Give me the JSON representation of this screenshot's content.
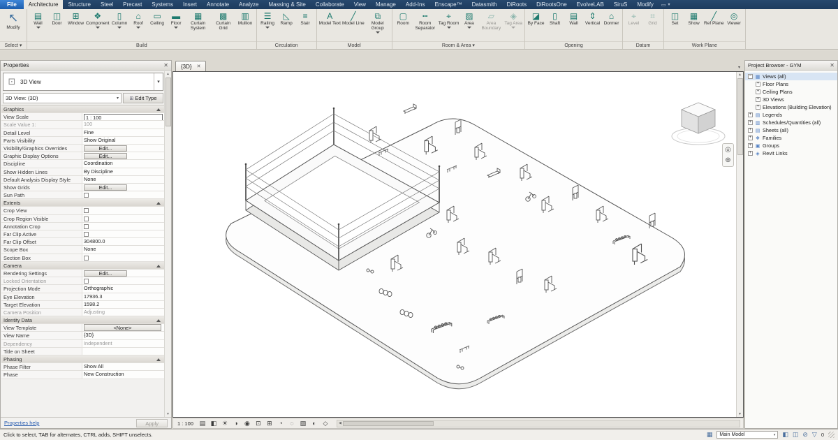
{
  "icons": {
    "close": "✕",
    "dropdown": "▾",
    "up": "▲",
    "down": "▼",
    "left": "◀",
    "panel": "▭",
    "view3d": "⊡",
    "edittype": "⊞",
    "wheel": "◎",
    "pan": "⊕",
    "worksets": "▦",
    "designopt": "◧",
    "editable": "◫",
    "exclude": "⊘",
    "filter": "▽"
  },
  "ribbon": {
    "tabs": [
      {
        "label": "File",
        "cls": "file"
      },
      {
        "label": "Architecture",
        "cls": "active"
      },
      {
        "label": "Structure",
        "cls": ""
      },
      {
        "label": "Steel",
        "cls": ""
      },
      {
        "label": "Precast",
        "cls": ""
      },
      {
        "label": "Systems",
        "cls": ""
      },
      {
        "label": "Insert",
        "cls": ""
      },
      {
        "label": "Annotate",
        "cls": ""
      },
      {
        "label": "Analyze",
        "cls": ""
      },
      {
        "label": "Massing & Site",
        "cls": ""
      },
      {
        "label": "Collaborate",
        "cls": ""
      },
      {
        "label": "View",
        "cls": ""
      },
      {
        "label": "Manage",
        "cls": ""
      },
      {
        "label": "Add-Ins",
        "cls": ""
      },
      {
        "label": "Enscape™",
        "cls": ""
      },
      {
        "label": "Datasmith",
        "cls": ""
      },
      {
        "label": "DiRoots",
        "cls": ""
      },
      {
        "label": "DiRootsOne",
        "cls": ""
      },
      {
        "label": "EvolveLAB",
        "cls": ""
      },
      {
        "label": "SiruS",
        "cls": ""
      },
      {
        "label": "Modify",
        "cls": ""
      }
    ],
    "select": {
      "label": "Select ▾",
      "items": [
        {
          "label": "Modify",
          "glyph": "↖",
          "cls": "big"
        }
      ]
    },
    "build": {
      "label": "Build",
      "items": [
        {
          "label": "Wall",
          "glyph": "▤",
          "cls": "has-arrow"
        },
        {
          "label": "Door",
          "glyph": "◫",
          "cls": ""
        },
        {
          "label": "Window",
          "glyph": "⊞",
          "cls": ""
        },
        {
          "label": "Component",
          "glyph": "❖",
          "cls": "has-arrow"
        },
        {
          "label": "Column",
          "glyph": "▯",
          "cls": "has-arrow"
        },
        {
          "label": "Roof",
          "glyph": "⌂",
          "cls": "has-arrow"
        },
        {
          "label": "Ceiling",
          "glyph": "▭",
          "cls": ""
        },
        {
          "label": "Floor",
          "glyph": "▬",
          "cls": "has-arrow"
        },
        {
          "label": "Curtain System",
          "glyph": "▦",
          "cls": ""
        },
        {
          "label": "Curtain Grid",
          "glyph": "▩",
          "cls": ""
        },
        {
          "label": "Mullion",
          "glyph": "▥",
          "cls": ""
        }
      ]
    },
    "circulation": {
      "label": "Circulation",
      "items": [
        {
          "label": "Railing",
          "glyph": "☰",
          "cls": "has-arrow"
        },
        {
          "label": "Ramp",
          "glyph": "◺",
          "cls": ""
        },
        {
          "label": "Stair",
          "glyph": "≡",
          "cls": ""
        }
      ]
    },
    "model": {
      "label": "Model",
      "items": [
        {
          "label": "Model Text",
          "glyph": "A",
          "cls": ""
        },
        {
          "label": "Model Line",
          "glyph": "╱",
          "cls": ""
        },
        {
          "label": "Model Group",
          "glyph": "⧉",
          "cls": "has-arrow"
        }
      ]
    },
    "room": {
      "label": "Room & Area ▾",
      "items": [
        {
          "label": "Room",
          "glyph": "▢",
          "cls": ""
        },
        {
          "label": "Room Separator",
          "glyph": "┅",
          "cls": ""
        },
        {
          "label": "Tag Room",
          "glyph": "⌖",
          "cls": "has-arrow"
        },
        {
          "label": "Area",
          "glyph": "▨",
          "cls": "has-arrow"
        },
        {
          "label": "Area Boundary",
          "glyph": "▱",
          "cls": "dim"
        },
        {
          "label": "Tag Area",
          "glyph": "◈",
          "cls": "has-arrow dim"
        }
      ]
    },
    "opening": {
      "label": "Opening",
      "items": [
        {
          "label": "By Face",
          "glyph": "◪",
          "cls": ""
        },
        {
          "label": "Shaft",
          "glyph": "▯",
          "cls": ""
        },
        {
          "label": "Wall",
          "glyph": "▤",
          "cls": ""
        },
        {
          "label": "Vertical",
          "glyph": "⇕",
          "cls": ""
        },
        {
          "label": "Dormer",
          "glyph": "⌂",
          "cls": ""
        }
      ]
    },
    "datum": {
      "label": "Datum",
      "items": [
        {
          "label": "Level",
          "glyph": "⌖",
          "cls": "dim"
        },
        {
          "label": "Grid",
          "glyph": "⌗",
          "cls": "dim"
        }
      ]
    },
    "workplane": {
      "label": "Work Plane",
      "items": [
        {
          "label": "Set",
          "glyph": "◫",
          "cls": ""
        },
        {
          "label": "Show",
          "glyph": "▦",
          "cls": ""
        },
        {
          "label": "Ref Plane",
          "glyph": "╱",
          "cls": ""
        },
        {
          "label": "Viewer",
          "glyph": "◎",
          "cls": ""
        }
      ]
    }
  },
  "properties": {
    "title": "Properties",
    "type_selector": "3D View",
    "view_selector": "3D View: (3D)",
    "edit_type": "Edit Type",
    "help": "Properties help",
    "apply": "Apply",
    "rows": [
      {
        "label": "Graphics",
        "value": "",
        "cls": "header"
      },
      {
        "label": "View Scale",
        "value": "1 : 100",
        "cls": "input"
      },
      {
        "label": "Scale Value    1:",
        "value": "100",
        "cls": "dim"
      },
      {
        "label": "Detail Level",
        "value": "Fine",
        "cls": ""
      },
      {
        "label": "Parts Visibility",
        "value": "Show Original",
        "cls": ""
      },
      {
        "label": "Visibility/Graphics Overrides",
        "value": "Edit...",
        "cls": "edit"
      },
      {
        "label": "Graphic Display Options",
        "value": "Edit...",
        "cls": "edit"
      },
      {
        "label": "Discipline",
        "value": "Coordination",
        "cls": ""
      },
      {
        "label": "Show Hidden Lines",
        "value": "By Discipline",
        "cls": ""
      },
      {
        "label": "Default Analysis Display Style",
        "value": "None",
        "cls": ""
      },
      {
        "label": "Show Grids",
        "value": "Edit...",
        "cls": "edit"
      },
      {
        "label": "Sun Path",
        "value": "",
        "cls": "checkbox"
      },
      {
        "label": "Extents",
        "value": "",
        "cls": "header"
      },
      {
        "label": "Crop View",
        "value": "",
        "cls": "checkbox"
      },
      {
        "label": "Crop Region Visible",
        "value": "",
        "cls": "checkbox"
      },
      {
        "label": "Annotation Crop",
        "value": "",
        "cls": "checkbox"
      },
      {
        "label": "Far Clip Active",
        "value": "",
        "cls": "checkbox"
      },
      {
        "label": "Far Clip Offset",
        "value": "304800.0",
        "cls": ""
      },
      {
        "label": "Scope Box",
        "value": "None",
        "cls": ""
      },
      {
        "label": "Section Box",
        "value": "",
        "cls": "checkbox"
      },
      {
        "label": "Camera",
        "value": "",
        "cls": "header"
      },
      {
        "label": "Rendering Settings",
        "value": "Edit...",
        "cls": "edit"
      },
      {
        "label": "Locked Orientation",
        "value": "",
        "cls": "checkbox dim"
      },
      {
        "label": "Projection Mode",
        "value": "Orthographic",
        "cls": ""
      },
      {
        "label": "Eye Elevation",
        "value": "17936.3",
        "cls": ""
      },
      {
        "label": "Target Elevation",
        "value": "1598.2",
        "cls": ""
      },
      {
        "label": "Camera Position",
        "value": "Adjusting",
        "cls": "dim"
      },
      {
        "label": "Identity Data",
        "value": "",
        "cls": "header"
      },
      {
        "label": "View Template",
        "value": "<None>",
        "cls": "btnc"
      },
      {
        "label": "View Name",
        "value": "{3D}",
        "cls": ""
      },
      {
        "label": "Dependency",
        "value": "Independent",
        "cls": "dim"
      },
      {
        "label": "Title on Sheet",
        "value": "",
        "cls": ""
      },
      {
        "label": "Phasing",
        "value": "",
        "cls": "header"
      },
      {
        "label": "Phase Filter",
        "value": "Show All",
        "cls": ""
      },
      {
        "label": "Phase",
        "value": "New Construction",
        "cls": ""
      }
    ]
  },
  "viewport": {
    "tab": "{3D}",
    "vcb_scale": "1 : 100",
    "vcb_icons": [
      {
        "glyph": "▤",
        "name": "detail-level-icon"
      },
      {
        "glyph": "◧",
        "name": "visual-style-icon"
      },
      {
        "glyph": "☀",
        "name": "sun-path-icon"
      },
      {
        "glyph": "◑",
        "name": "shadows-icon"
      },
      {
        "glyph": "◉",
        "name": "rendering-dialog-icon"
      },
      {
        "glyph": "⊡",
        "name": "crop-view-icon"
      },
      {
        "glyph": "⊞",
        "name": "show-crop-region-icon"
      },
      {
        "glyph": "◔",
        "name": "temporary-hide-isolate-icon"
      },
      {
        "glyph": "◌",
        "name": "reveal-hidden-elements-icon"
      },
      {
        "glyph": "▧",
        "name": "worksharing-display-icon"
      },
      {
        "glyph": "◐",
        "name": "temporary-view-properties-icon"
      },
      {
        "glyph": "◇",
        "name": "displaced-elements-icon"
      }
    ]
  },
  "browser": {
    "title": "Project Browser - GYM",
    "items": [
      {
        "label": "Views (all)",
        "glyph": "▦",
        "cls": "d0 sel",
        "expGlyph": "−"
      },
      {
        "label": "Floor Plans",
        "glyph": "",
        "cls": "d1",
        "expGlyph": "+"
      },
      {
        "label": "Ceiling Plans",
        "glyph": "",
        "cls": "d1",
        "expGlyph": "+"
      },
      {
        "label": "3D Views",
        "glyph": "",
        "cls": "d1",
        "expGlyph": "+"
      },
      {
        "label": "Elevations (Building Elevation)",
        "glyph": "",
        "cls": "d1",
        "expGlyph": "+"
      },
      {
        "label": "Legends",
        "glyph": "▤",
        "cls": "d0",
        "expGlyph": "+"
      },
      {
        "label": "Schedules/Quantities (all)",
        "glyph": "▥",
        "cls": "d0",
        "expGlyph": "+"
      },
      {
        "label": "Sheets (all)",
        "glyph": "▤",
        "cls": "d0",
        "expGlyph": "+"
      },
      {
        "label": "Families",
        "glyph": "❖",
        "cls": "d0",
        "expGlyph": "+"
      },
      {
        "label": "Groups",
        "glyph": "▣",
        "cls": "d0",
        "expGlyph": "+"
      },
      {
        "label": "Revit Links",
        "glyph": "◈",
        "cls": "d0",
        "expGlyph": "+"
      }
    ]
  },
  "statusbar": {
    "hint": "Click to select, TAB for alternates, CTRL adds, SHIFT unselects.",
    "main_model": "Main Model",
    "filter_count": "0"
  }
}
